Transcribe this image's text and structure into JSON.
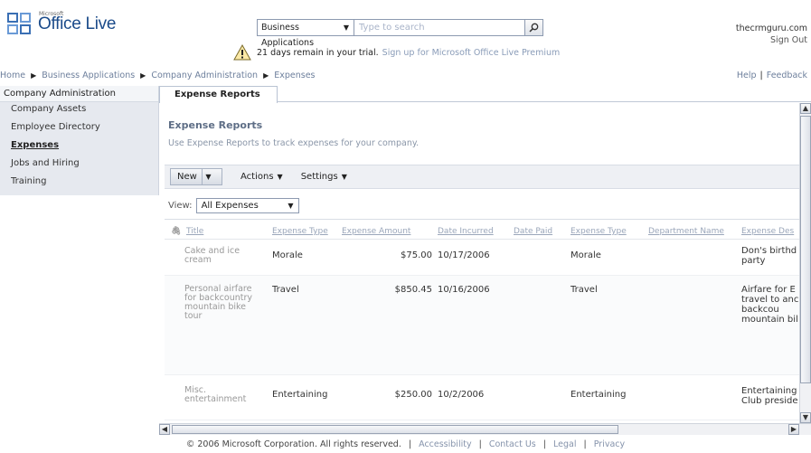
{
  "header": {
    "logo_small": "Microsoft",
    "logo_name": "Office Live",
    "search_scope": "Business Applications",
    "search_placeholder": "Type to search",
    "account_name": "thecrmguru.com",
    "sign_out": "Sign Out"
  },
  "trial": {
    "message": "21 days remain in your trial.",
    "link": "Sign up for Microsoft Office Live Premium"
  },
  "breadcrumb": {
    "items": [
      "Home",
      "Business Applications",
      "Company Administration",
      "Expenses"
    ]
  },
  "helplinks": {
    "help": "Help",
    "feedback": "Feedback"
  },
  "sidebar": {
    "heading": "Company Administration",
    "items": [
      {
        "label": "Company Assets"
      },
      {
        "label": "Employee Directory"
      },
      {
        "label": "Expenses"
      },
      {
        "label": "Jobs and Hiring"
      },
      {
        "label": "Training"
      }
    ]
  },
  "tab": {
    "label": "Expense Reports"
  },
  "main": {
    "title": "Expense Reports",
    "description": "Use Expense Reports to track expenses for your company.",
    "toolbar": {
      "new": "New",
      "actions": "Actions",
      "settings": "Settings"
    },
    "view_label": "View:",
    "view_value": "All Expenses"
  },
  "table": {
    "columns": [
      "Title",
      "Expense Type",
      "Expense Amount",
      "Date Incurred",
      "Date Paid",
      "Expense Type",
      "Department Name",
      "Expense Des"
    ],
    "rows": [
      {
        "title": "Cake and ice cream",
        "type": "Morale",
        "amount": "$75.00",
        "date": "10/17/2006",
        "type2": "Morale",
        "desc": "Don's birthd party"
      },
      {
        "title": "Personal airfare for backcountry mountain bike tour",
        "type": "Travel",
        "amount": "$850.45",
        "date": "10/16/2006",
        "type2": "Travel",
        "desc": "Airfare for E travel to anc the backcou mountain bil"
      },
      {
        "title": "Misc. entertainment",
        "type": "Entertaining",
        "amount": "$250.00",
        "date": "10/2/2006",
        "type2": "Entertaining",
        "desc": "Entertaining Club preside"
      }
    ]
  },
  "footer": {
    "copyright": "© 2006 Microsoft Corporation. All rights reserved.",
    "links": [
      "Accessibility",
      "Contact Us",
      "Legal",
      "Privacy"
    ]
  }
}
